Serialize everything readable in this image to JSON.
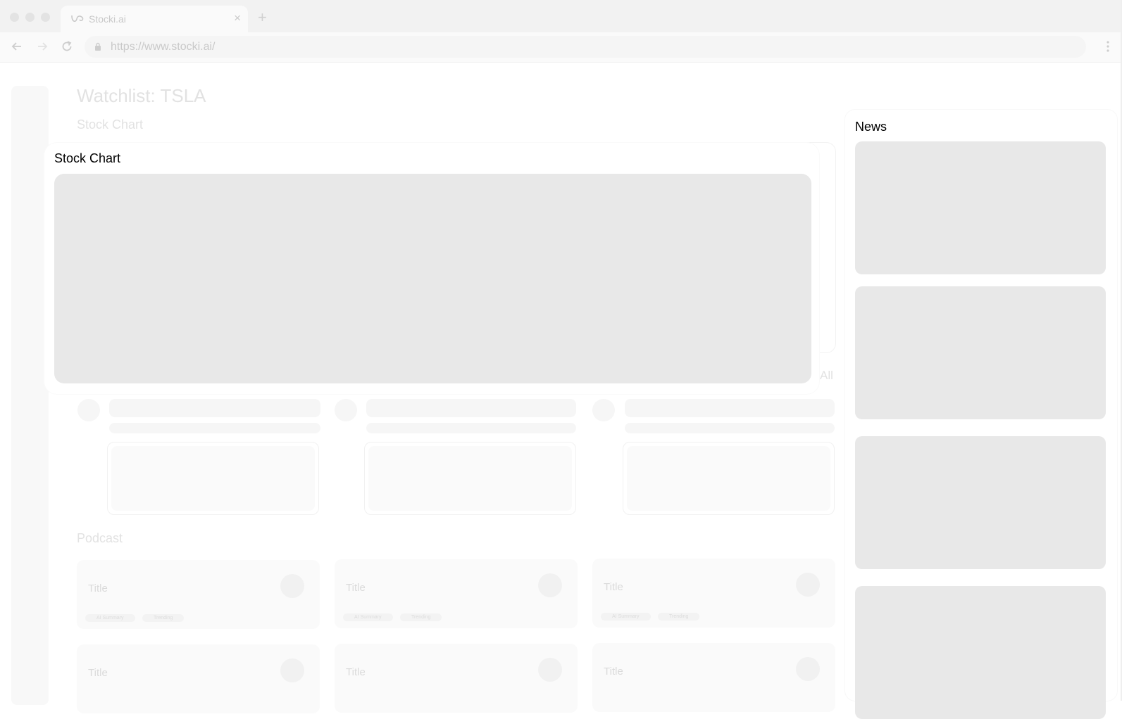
{
  "browser": {
    "tab_title": "Stocki.ai",
    "tab_close": "×",
    "new_tab": "+",
    "url": "https://www.stocki.ai/"
  },
  "page": {
    "title": "Watchlist: TSLA",
    "stock_chart_label": "Stock Chart",
    "all_link": "All",
    "podcast_label": "Podcast"
  },
  "stock_chart_card": {
    "title": "Stock Chart"
  },
  "news": {
    "title": "News"
  },
  "podcast_cards": [
    {
      "title": "Title",
      "tags": [
        "AI Summary",
        "Trending"
      ]
    },
    {
      "title": "Title",
      "tags": [
        "AI Summary",
        "Trending"
      ]
    },
    {
      "title": "Title",
      "tags": [
        "AI Summary",
        "Trending"
      ]
    },
    {
      "title": "Title"
    },
    {
      "title": "Title"
    },
    {
      "title": "Title"
    }
  ],
  "colors": {
    "placeholder_gray": "#e8e8e8",
    "faded_text": "#e2e2e2",
    "chrome_bg": "#f2f2f2"
  }
}
